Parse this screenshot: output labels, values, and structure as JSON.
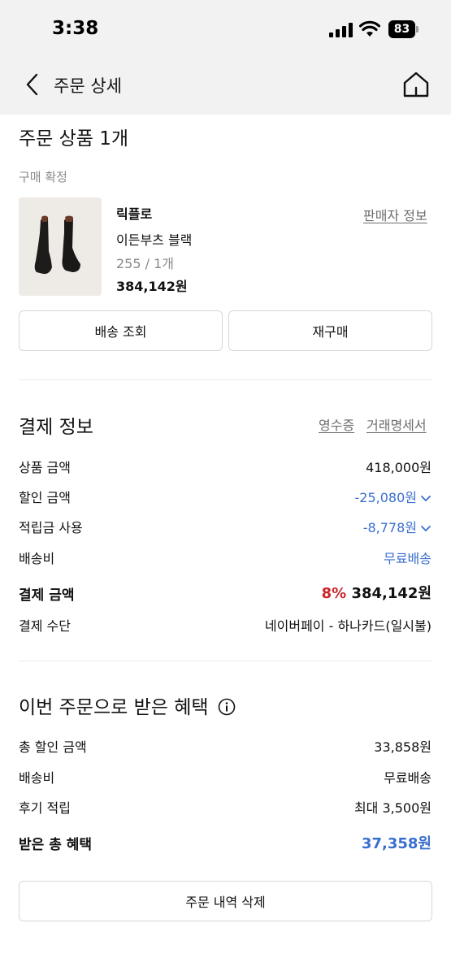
{
  "status_bar": {
    "time": "3:38",
    "battery": "83"
  },
  "header": {
    "title": "주문 상세"
  },
  "order": {
    "section_title": "주문 상품 1개",
    "status": "구매 확정",
    "brand": "릭플로",
    "seller_info_link": "판매자 정보",
    "product_name": "이든부츠 블랙",
    "option": "255 / 1개",
    "price": "384,142원",
    "track_button": "배송 조회",
    "reorder_button": "재구매"
  },
  "payment": {
    "section_title": "결제 정보",
    "receipt_link": "영수증",
    "statement_link": "거래명세서",
    "rows": [
      {
        "label": "상품 금액",
        "value": "418,000원"
      },
      {
        "label": "할인 금액",
        "value": "-25,080원"
      },
      {
        "label": "적립금 사용",
        "value": "-8,778원"
      },
      {
        "label": "배송비",
        "value": "무료배송"
      }
    ],
    "total_label": "결제 금액",
    "total_discount_rate": "8%",
    "total_value": "384,142원",
    "method_label": "결제 수단",
    "method_value": "네이버페이 - 하나카드(일시불)"
  },
  "benefits": {
    "section_title": "이번 주문으로 받은 혜택",
    "rows": [
      {
        "label": "총 할인 금액",
        "value": "33,858원"
      },
      {
        "label": "배송비",
        "value": "무료배송"
      },
      {
        "label": "후기 적립",
        "value": "최대 3,500원"
      }
    ],
    "total_label": "받은 총 혜택",
    "total_value": "37,358원"
  },
  "delete_button": "주문 내역 삭제",
  "colors": {
    "accent_blue": "#3a6fcf",
    "discount_red": "#c8262b",
    "header_bg": "#f2f2f3"
  },
  "icons": [
    "signal-icon",
    "wifi-icon",
    "battery-icon",
    "back-arrow-icon",
    "home-icon",
    "info-icon",
    "chevron-down-icon"
  ]
}
